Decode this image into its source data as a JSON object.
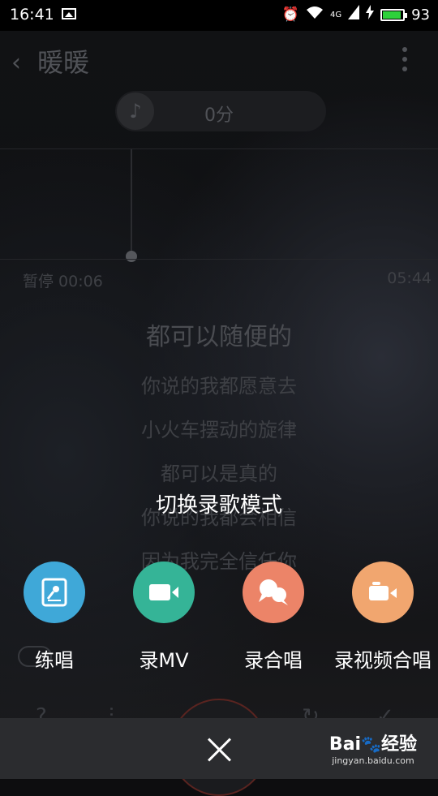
{
  "status_bar": {
    "time": "16:41",
    "network": "4G",
    "battery_percent": "93",
    "battery_level": 0.93
  },
  "header": {
    "title": "暖暖"
  },
  "score": {
    "text": "0分"
  },
  "playback": {
    "elapsed": "暂停 00:06",
    "duration": "05:44"
  },
  "lyrics": [
    {
      "text": "都可以随便的",
      "current": true
    },
    {
      "text": "你说的我都愿意去",
      "current": false
    },
    {
      "text": "小火车摆动的旋律",
      "current": false
    },
    {
      "text": "都可以是真的",
      "current": false
    },
    {
      "text": "你说的我都会相信",
      "current": false
    },
    {
      "text": "因为我完全信任你",
      "current": false
    },
    {
      "text": "",
      "current": false
    }
  ],
  "sheet": {
    "title": "切换录歌模式",
    "modes": [
      {
        "label": "练唱",
        "icon": "practice-mic-icon",
        "color": "#3fa8d8"
      },
      {
        "label": "录MV",
        "icon": "video-camera-icon",
        "color": "#35b497"
      },
      {
        "label": "录合唱",
        "icon": "duet-chat-icon",
        "color": "#ec8468"
      },
      {
        "label": "录视频合唱",
        "icon": "video-duet-icon",
        "color": "#f1a66f"
      }
    ],
    "close_icon": "close-icon"
  },
  "watermark": {
    "brand": "Bai",
    "brand_cn": "经验",
    "url": "jingyan.baidu.com"
  }
}
